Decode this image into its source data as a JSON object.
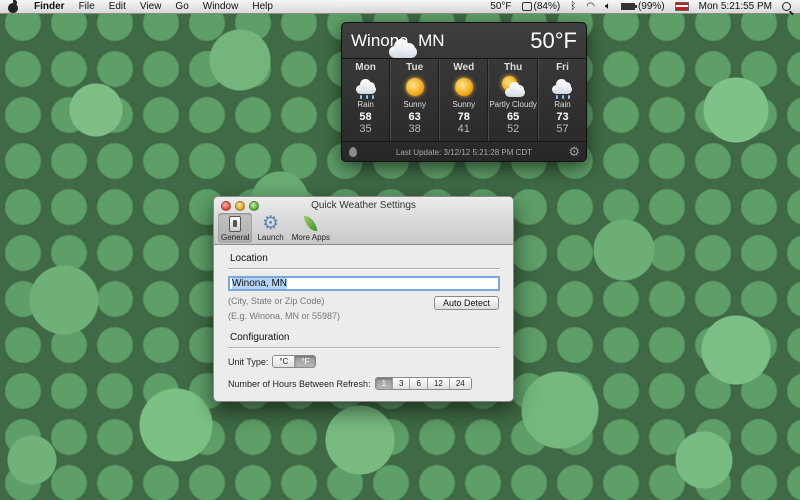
{
  "menubar": {
    "app_name": "Finder",
    "menus": [
      "File",
      "Edit",
      "View",
      "Go",
      "Window",
      "Help"
    ],
    "temp": "50°F",
    "battery_1": "(84%)",
    "battery_1_level": 0.84,
    "battery_2": "(99%)",
    "battery_2_level": 0.99,
    "clock": "Mon 5:21:55 PM"
  },
  "weather": {
    "city": "Winona, MN",
    "current_temp": "50°F",
    "days": [
      {
        "name": "Mon",
        "condition": "Rain",
        "icon": "rain-icon",
        "high": "58",
        "low": "35"
      },
      {
        "name": "Tue",
        "condition": "Sunny",
        "icon": "sun-icon",
        "high": "63",
        "low": "38"
      },
      {
        "name": "Wed",
        "condition": "Sunny",
        "icon": "sun-icon",
        "high": "78",
        "low": "41"
      },
      {
        "name": "Thu",
        "condition": "Partly Cloudy",
        "icon": "partly-cloudy-icon",
        "high": "65",
        "low": "52"
      },
      {
        "name": "Fri",
        "condition": "Rain",
        "icon": "rain-icon",
        "high": "73",
        "low": "57"
      }
    ],
    "last_update": "Last Update: 3/12/12 5:21:28 PM CDT"
  },
  "settings": {
    "window_title": "Quick Weather Settings",
    "tabs": [
      "General",
      "Launch",
      "More Apps"
    ],
    "location_label": "Location",
    "location_value": "Winona, MN",
    "hint_1": "(City, State or Zip Code)",
    "hint_2": "(E.g. Winona, MN or 55987)",
    "auto_detect": "Auto Detect",
    "config_label": "Configuration",
    "unit_label": "Unit Type:",
    "units": [
      "°C",
      "°F"
    ],
    "unit_selected": "°F",
    "refresh_label": "Number of Hours Between Refresh:",
    "refresh_options": [
      "1",
      "3",
      "6",
      "12",
      "24"
    ],
    "refresh_selected": "1"
  }
}
